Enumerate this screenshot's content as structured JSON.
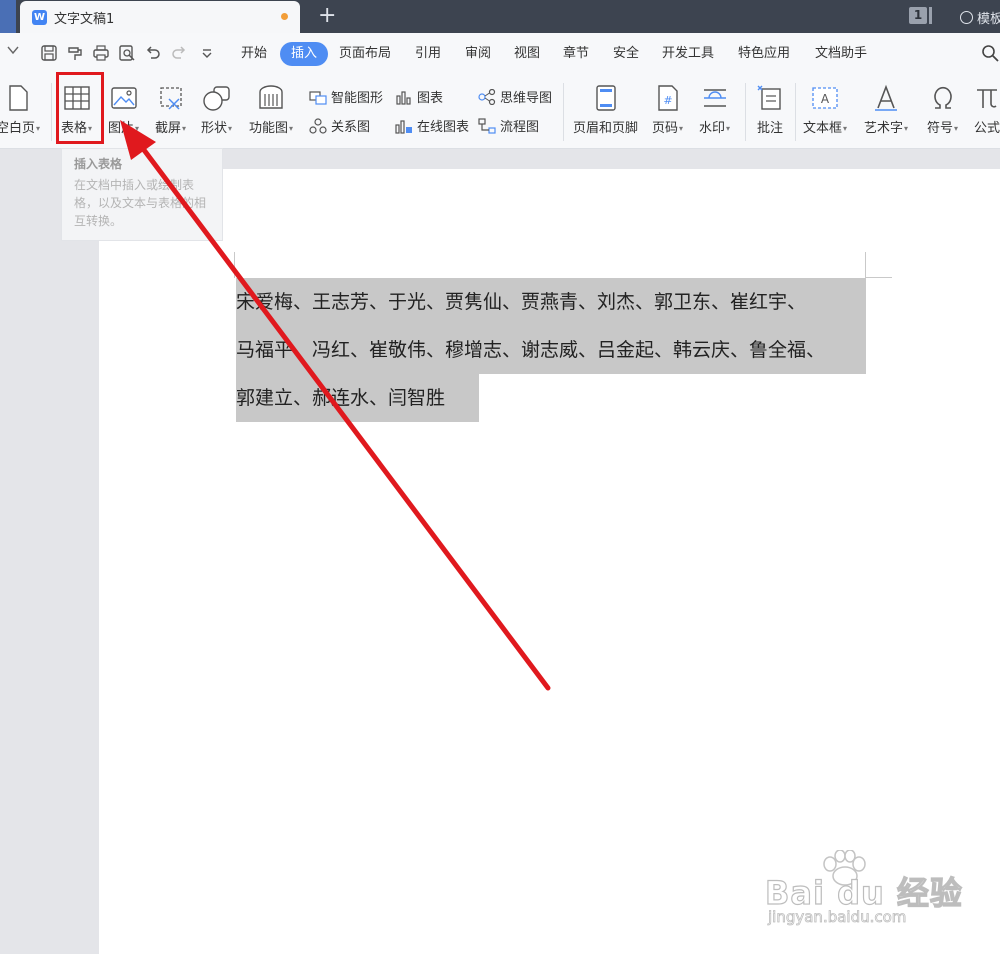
{
  "titlebar": {
    "doc_icon": "W",
    "doc_title": "文字文稿1",
    "new_tab_symbol": "+",
    "window_count": "1",
    "template_label": "模板"
  },
  "menubar": {
    "items": [
      "开始",
      "插入",
      "页面布局",
      "引用",
      "审阅",
      "视图",
      "章节",
      "安全",
      "开发工具",
      "特色应用",
      "文档助手"
    ],
    "active": "插入"
  },
  "ribbon": {
    "blank_page": "空白页",
    "table": "表格",
    "picture": "图片",
    "screenshot": "截屏",
    "shape": "形状",
    "function_chart": "功能图",
    "smart_shape": "智能图形",
    "chart": "图表",
    "mind_map": "思维导图",
    "relation_chart": "关系图",
    "online_chart": "在线图表",
    "flowchart": "流程图",
    "header_footer": "页眉和页脚",
    "page_number": "页码",
    "watermark": "水印",
    "comment": "批注",
    "text_box": "文本框",
    "art_text": "艺术字",
    "symbol": "符号",
    "formula": "公式",
    "dropdown_glyph": "▾"
  },
  "tooltip": {
    "title": "插入表格",
    "description": "在文档中插入或绘制表格，以及文本与表格的相互转换。"
  },
  "document": {
    "lines": [
      "宋爱梅、王志芳、于光、贾隽仙、贾燕青、刘杰、郭卫东、崔红宇、",
      "马福平、冯红、崔敬伟、穆增志、谢志威、吕金起、韩云庆、鲁全福、",
      "郭建立、郝连水、闫智胜"
    ]
  },
  "watermark": {
    "brand": "Bai du 经验",
    "url": "jingyan.baidu.com"
  },
  "colors": {
    "accent": "#4f8df3",
    "annotation": "#e0191e",
    "selection": "#c8c8c8"
  }
}
